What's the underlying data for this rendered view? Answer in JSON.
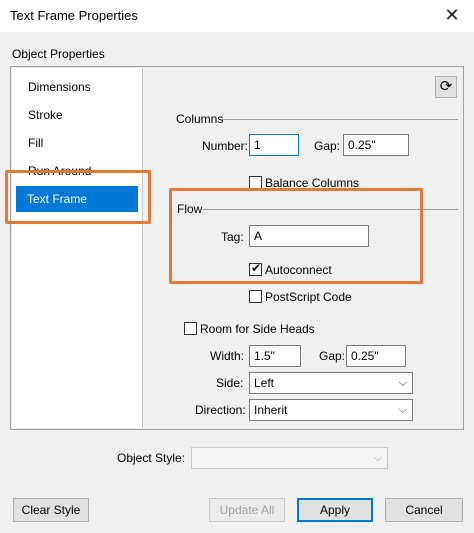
{
  "window": {
    "title": "Text Frame Properties",
    "close_glyph": "✕"
  },
  "section_label": "Object Properties",
  "nav": {
    "items": [
      {
        "label": "Dimensions"
      },
      {
        "label": "Stroke"
      },
      {
        "label": "Fill"
      },
      {
        "label": "Run Around"
      },
      {
        "label": "Text Frame",
        "selected": true
      }
    ]
  },
  "refresh": {
    "icon": "refresh-icon",
    "glyph": "⟳"
  },
  "columns": {
    "title": "Columns",
    "number_label": "Number:",
    "number_value": "1",
    "gap_label": "Gap:",
    "gap_value": "0.25\"",
    "balance_label": "Balance Columns",
    "balance_checked": false
  },
  "flow": {
    "title": "Flow",
    "tag_label": "Tag:",
    "tag_value": "A",
    "autoconnect_label": "Autoconnect",
    "autoconnect_checked": true,
    "postscript_label": "PostScript Code",
    "postscript_checked": false
  },
  "side_heads": {
    "room_label": "Room for Side Heads",
    "room_checked": false,
    "width_label": "Width:",
    "width_value": "1.5\"",
    "gap_label": "Gap:",
    "gap_value": "0.25\"",
    "side_label": "Side:",
    "side_value": "Left",
    "direction_label": "Direction:",
    "direction_value": "Inherit"
  },
  "object_style": {
    "label": "Object Style:",
    "value": ""
  },
  "buttons": {
    "clear_style": "Clear Style",
    "update_all": "Update All",
    "apply": "Apply",
    "cancel": "Cancel"
  },
  "colors": {
    "accent": "#0078d7",
    "highlight": "#e07a3a"
  }
}
